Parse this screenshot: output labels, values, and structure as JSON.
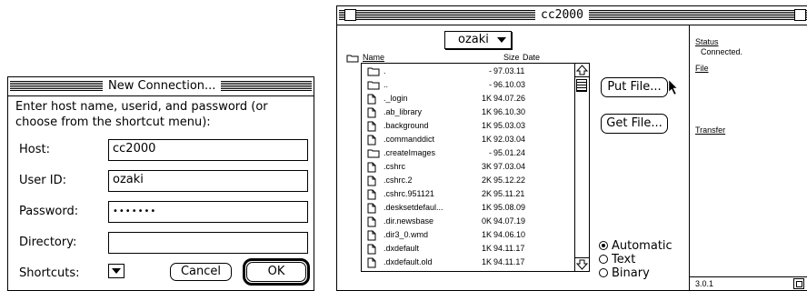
{
  "dialog": {
    "title": "New Connection...",
    "prompt_line1": "Enter host name, userid, and password (or",
    "prompt_line2": "choose from the shortcut menu):",
    "host_label": "Host:",
    "host_value": "cc2000",
    "userid_label": "User ID:",
    "userid_value": "ozaki",
    "password_label": "Password:",
    "password_value": "•••••••",
    "directory_label": "Directory:",
    "directory_value": "",
    "shortcuts_label": "Shortcuts:",
    "cancel_label": "Cancel",
    "ok_label": "OK"
  },
  "ftp": {
    "title": "cc2000",
    "folder_popup": "ozaki",
    "col_name": "Name",
    "col_size": "Size",
    "col_date": "Date",
    "files": [
      {
        "icon": "folder-icon",
        "name": ".",
        "size": "-",
        "date": "97.03.11"
      },
      {
        "icon": "folder-icon",
        "name": "..",
        "size": "-",
        "date": "96.10.03"
      },
      {
        "icon": "document-icon",
        "name": "._login",
        "size": "1K",
        "date": "94.07.26"
      },
      {
        "icon": "document-icon",
        "name": ".ab_library",
        "size": "1K",
        "date": "96.10.30"
      },
      {
        "icon": "document-icon",
        "name": ".background",
        "size": "1K",
        "date": "95.03.03"
      },
      {
        "icon": "document-icon",
        "name": ".commanddict",
        "size": "1K",
        "date": "92.03.04"
      },
      {
        "icon": "folder-icon",
        "name": ".createImages",
        "size": "-",
        "date": "95.01.24"
      },
      {
        "icon": "document-icon",
        "name": ".cshrc",
        "size": "3K",
        "date": "97.03.04"
      },
      {
        "icon": "document-icon",
        "name": ".cshrc.2",
        "size": "2K",
        "date": "95.12.22"
      },
      {
        "icon": "document-icon",
        "name": ".cshrc.951121",
        "size": "2K",
        "date": "95.11.21"
      },
      {
        "icon": "document-icon",
        "name": ".desksetdefaul...",
        "size": "1K",
        "date": "95.08.09"
      },
      {
        "icon": "document-icon",
        "name": ".dir.newsbase",
        "size": "0K",
        "date": "94.07.19"
      },
      {
        "icon": "document-icon",
        "name": ".dir3_0.wmd",
        "size": "1K",
        "date": "94.06.10"
      },
      {
        "icon": "document-icon",
        "name": ".dxdefault",
        "size": "1K",
        "date": "94.11.17"
      },
      {
        "icon": "document-icon",
        "name": ".dxdefault.old",
        "size": "1K",
        "date": "94.11.17"
      }
    ],
    "put_label": "Put File...",
    "get_label": "Get File...",
    "modes": [
      {
        "label": "Automatic",
        "selected": true
      },
      {
        "label": "Text",
        "selected": false
      },
      {
        "label": "Binary",
        "selected": false
      }
    ],
    "status_heading": "Status",
    "status_value": "Connected.",
    "file_heading": "File",
    "transfer_heading": "Transfer",
    "version": "3.0.1"
  }
}
